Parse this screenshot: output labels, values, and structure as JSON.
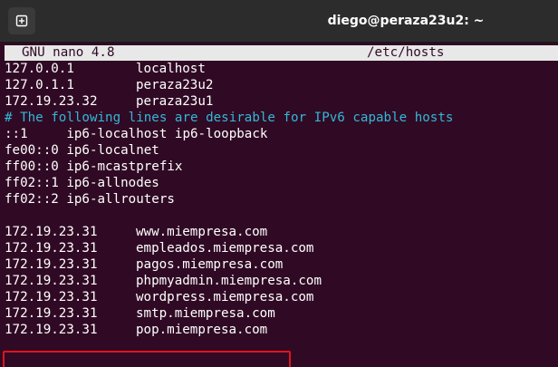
{
  "window": {
    "title": "diego@peraza23u2: ~"
  },
  "icons": {
    "new_tab": "new-tab-plus-icon"
  },
  "nano": {
    "version": "GNU nano 4.8",
    "filename": "/etc/hosts"
  },
  "colors": {
    "terminal_bg": "#300a24",
    "comment": "#34b7d8",
    "highlight": "#e0141e"
  },
  "file_lines": [
    {
      "type": "host",
      "ip": "127.0.0.1",
      "name": "localhost"
    },
    {
      "type": "host",
      "ip": "127.0.1.1",
      "name": "peraza23u2"
    },
    {
      "type": "host",
      "ip": "172.19.23.32",
      "name": "peraza23u1"
    },
    {
      "type": "comment",
      "text": "# The following lines are desirable for IPv6 capable hosts"
    },
    {
      "type": "raw",
      "text": "::1     ip6-localhost ip6-loopback"
    },
    {
      "type": "raw",
      "text": "fe00::0 ip6-localnet"
    },
    {
      "type": "raw",
      "text": "ff00::0 ip6-mcastprefix"
    },
    {
      "type": "raw",
      "text": "ff02::1 ip6-allnodes"
    },
    {
      "type": "raw",
      "text": "ff02::2 ip6-allrouters"
    },
    {
      "type": "blank",
      "text": ""
    },
    {
      "type": "host",
      "ip": "172.19.23.31",
      "name": "www.miempresa.com"
    },
    {
      "type": "host",
      "ip": "172.19.23.31",
      "name": "empleados.miempresa.com"
    },
    {
      "type": "host",
      "ip": "172.19.23.31",
      "name": "pagos.miempresa.com"
    },
    {
      "type": "host",
      "ip": "172.19.23.31",
      "name": "phpmyadmin.miempresa.com"
    },
    {
      "type": "host",
      "ip": "172.19.23.31",
      "name": "wordpress.miempresa.com"
    },
    {
      "type": "host",
      "ip": "172.19.23.31",
      "name": "smtp.miempresa.com"
    },
    {
      "type": "host",
      "ip": "172.19.23.31",
      "name": "pop.miempresa.com"
    }
  ]
}
